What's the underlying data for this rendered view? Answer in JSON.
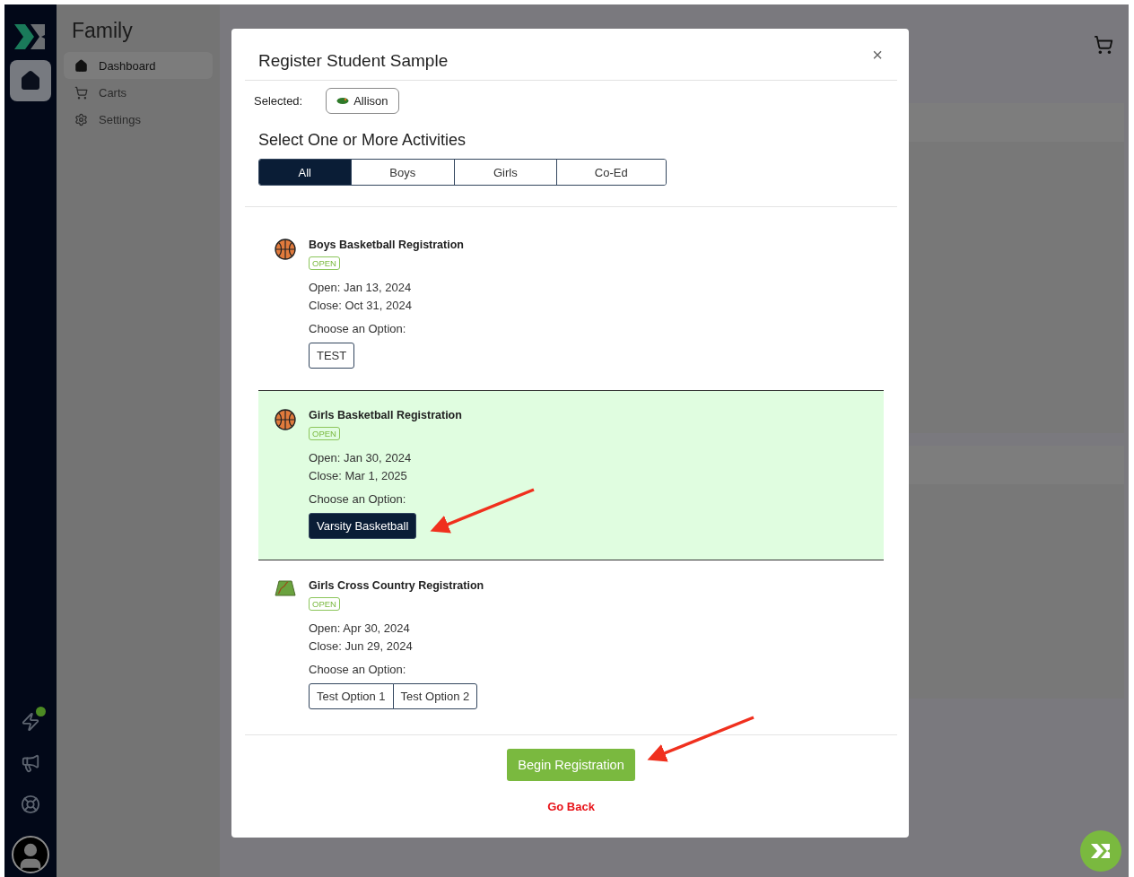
{
  "sidebar": {
    "title": "Family",
    "items": [
      {
        "label": "Dashboard",
        "kind": "home",
        "selected": true
      },
      {
        "label": "Carts",
        "kind": "cart",
        "selected": false
      },
      {
        "label": "Settings",
        "kind": "gear",
        "selected": false
      }
    ]
  },
  "modal": {
    "title": "Register Student Sample",
    "close": "×",
    "selected_label": "Selected:",
    "student": "Allison",
    "heading": "Select One or More Activities",
    "tabs": [
      {
        "label": "All",
        "selected": true
      },
      {
        "label": "Boys",
        "selected": false
      },
      {
        "label": "Girls",
        "selected": false
      },
      {
        "label": "Co-Ed",
        "selected": false
      }
    ],
    "activities": [
      {
        "name": "Boys Basketball Registration",
        "kind": "basketball",
        "status": "OPEN",
        "open": "Open: Jan 13, 2024",
        "close": "Close: Oct 31, 2024",
        "prompt": "Choose an Option:",
        "selected": false,
        "options": [
          {
            "label": "TEST",
            "selected": false
          }
        ]
      },
      {
        "name": "Girls Basketball Registration",
        "kind": "basketball",
        "status": "OPEN",
        "open": "Open: Jan 30, 2024",
        "close": "Close: Mar 1, 2025",
        "prompt": "Choose an Option:",
        "selected": true,
        "options": [
          {
            "label": "Varsity Basketball",
            "selected": true
          }
        ]
      },
      {
        "name": "Girls Cross Country Registration",
        "kind": "cross-country",
        "status": "OPEN",
        "open": "Open: Apr 30, 2024",
        "close": "Close: Jun 29, 2024",
        "prompt": "Choose an Option:",
        "selected": false,
        "options": [
          {
            "label": "Test Option 1",
            "selected": false
          },
          {
            "label": "Test Option 2",
            "selected": false
          }
        ]
      }
    ],
    "primary_button": "Begin Registration",
    "back_link": "Go Back"
  }
}
